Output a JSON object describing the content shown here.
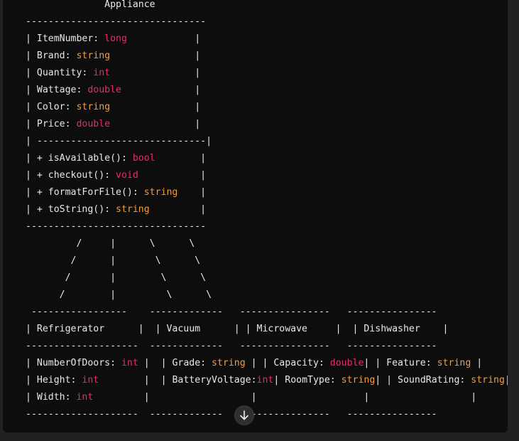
{
  "colors": {
    "background": "#0d0d0d",
    "text": "#e8e8e8",
    "keyword": "#f0266f",
    "string_type": "#f59b3d"
  },
  "code_lines": [
    [
      {
        "t": "              Appliance",
        "c": "plain"
      }
    ],
    [
      {
        "t": "--------------------------------",
        "c": "plain"
      }
    ],
    [
      {
        "t": "| ItemNumber: ",
        "c": "plain"
      },
      {
        "t": "long",
        "c": "type-kw"
      },
      {
        "t": "            |",
        "c": "plain"
      }
    ],
    [
      {
        "t": "| Brand: ",
        "c": "plain"
      },
      {
        "t": "string",
        "c": "type-str"
      },
      {
        "t": "               |",
        "c": "plain"
      }
    ],
    [
      {
        "t": "| Quantity: ",
        "c": "plain"
      },
      {
        "t": "int",
        "c": "type-kw"
      },
      {
        "t": "               |",
        "c": "plain"
      }
    ],
    [
      {
        "t": "| Wattage: ",
        "c": "plain"
      },
      {
        "t": "double",
        "c": "type-kw"
      },
      {
        "t": "             |",
        "c": "plain"
      }
    ],
    [
      {
        "t": "| Color: ",
        "c": "plain"
      },
      {
        "t": "string",
        "c": "type-str"
      },
      {
        "t": "               |",
        "c": "plain"
      }
    ],
    [
      {
        "t": "| Price: ",
        "c": "plain"
      },
      {
        "t": "double",
        "c": "type-kw"
      },
      {
        "t": "               |",
        "c": "plain"
      }
    ],
    [
      {
        "t": "| ------------------------------|",
        "c": "plain"
      }
    ],
    [
      {
        "t": "| + isAvailable(): ",
        "c": "plain"
      },
      {
        "t": "bool",
        "c": "type-kw"
      },
      {
        "t": "        |",
        "c": "plain"
      }
    ],
    [
      {
        "t": "| + checkout(): ",
        "c": "plain"
      },
      {
        "t": "void",
        "c": "type-kw"
      },
      {
        "t": "           |",
        "c": "plain"
      }
    ],
    [
      {
        "t": "| + formatForFile(): ",
        "c": "plain"
      },
      {
        "t": "string",
        "c": "type-str"
      },
      {
        "t": "    |",
        "c": "plain"
      }
    ],
    [
      {
        "t": "| + toString(): ",
        "c": "plain"
      },
      {
        "t": "string",
        "c": "type-str"
      },
      {
        "t": "         |",
        "c": "plain"
      }
    ],
    [
      {
        "t": "--------------------------------",
        "c": "plain"
      }
    ],
    [
      {
        "t": "         /     |      \\      \\",
        "c": "plain"
      }
    ],
    [
      {
        "t": "        /      |       \\      \\",
        "c": "plain"
      }
    ],
    [
      {
        "t": "       /       |        \\      \\",
        "c": "plain"
      }
    ],
    [
      {
        "t": "      /        |         \\      \\",
        "c": "plain"
      }
    ],
    [
      {
        "t": " -----------------    -------------   ----------------   ----------------",
        "c": "plain"
      }
    ],
    [
      {
        "t": "| Refrigerator      |  | Vacuum      | | Microwave     |  | Dishwasher    |",
        "c": "plain"
      }
    ],
    [
      {
        "t": "--------------------  -------------   ----------------   ----------------",
        "c": "plain"
      }
    ],
    [
      {
        "t": "| NumberOfDoors: ",
        "c": "plain"
      },
      {
        "t": "int",
        "c": "type-kw"
      },
      {
        "t": " |  | Grade: ",
        "c": "plain"
      },
      {
        "t": "string",
        "c": "type-str"
      },
      {
        "t": " | | Capacity: ",
        "c": "plain"
      },
      {
        "t": "double",
        "c": "type-kw"
      },
      {
        "t": "| | Feature: ",
        "c": "plain"
      },
      {
        "t": "string",
        "c": "type-str"
      },
      {
        "t": " |",
        "c": "plain"
      }
    ],
    [
      {
        "t": "| Height: ",
        "c": "plain"
      },
      {
        "t": "int",
        "c": "type-kw"
      },
      {
        "t": "        |  | BatteryVoltage:",
        "c": "plain"
      },
      {
        "t": "int",
        "c": "type-kw"
      },
      {
        "t": "| RoomType: ",
        "c": "plain"
      },
      {
        "t": "string",
        "c": "type-str"
      },
      {
        "t": "| | SoundRating: ",
        "c": "plain"
      },
      {
        "t": "string",
        "c": "type-str"
      },
      {
        "t": "|",
        "c": "plain"
      }
    ],
    [
      {
        "t": "| Width: ",
        "c": "plain"
      },
      {
        "t": "int",
        "c": "type-kw"
      },
      {
        "t": "         |                  |                   |                  |",
        "c": "plain"
      }
    ],
    [
      {
        "t": "--------------------  -------------   ----------------   ----------------",
        "c": "plain"
      }
    ]
  ],
  "scroll_button": {
    "icon": "arrow-down-icon"
  }
}
